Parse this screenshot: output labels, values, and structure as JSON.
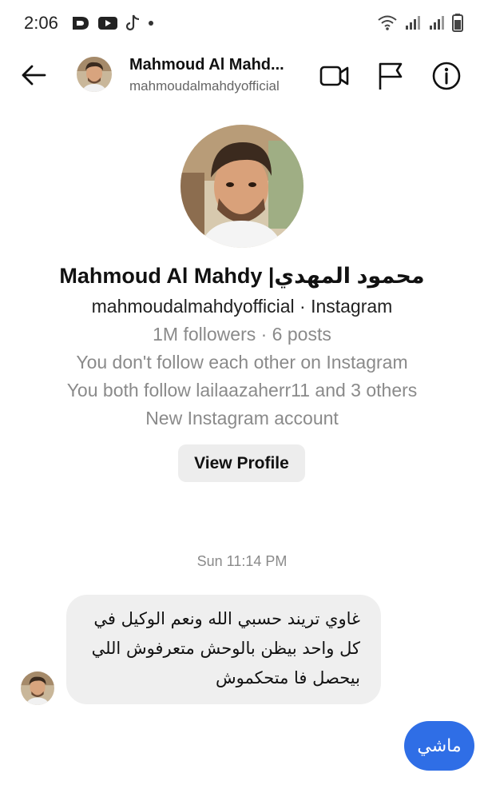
{
  "status_bar": {
    "time": "2:06",
    "left_icons": [
      "dazn-icon",
      "youtube-icon",
      "tiktok-icon",
      "dot-icon"
    ],
    "right_icons": [
      "wifi-icon",
      "signal-icon",
      "signal-icon",
      "battery-icon"
    ]
  },
  "header": {
    "name": "Mahmoud Al Mahd...",
    "username": "mahmoudalmahdyofficial",
    "icons": [
      "back-arrow-icon",
      "video-call-icon",
      "flag-icon",
      "info-icon"
    ]
  },
  "profile": {
    "name": "Mahmoud Al Mahdy |محمود المهدي",
    "username_line": "mahmoudalmahdyofficial · Instagram",
    "stats": "1M followers · 6 posts",
    "follow_status": "You don't follow each other on Instagram",
    "mutuals": "You both follow lailaazaherr11 and 3 others",
    "account_note": "New Instagram account",
    "view_button": "View Profile"
  },
  "conversation": {
    "timestamp": "Sun 11:14 PM",
    "messages": [
      {
        "direction": "incoming",
        "lines": [
          "غاوي تريند حسبي الله ونعم الوكيل في",
          "كل واحد بيظن بالوحش متعرفوش اللي",
          "بيحصل فا متحكموش"
        ]
      },
      {
        "direction": "outgoing",
        "text": "ماشي"
      }
    ]
  },
  "colors": {
    "outgoing_bubble": "#2f6ee6",
    "incoming_bubble": "#efefef",
    "secondary_text": "#8a8a8a"
  }
}
